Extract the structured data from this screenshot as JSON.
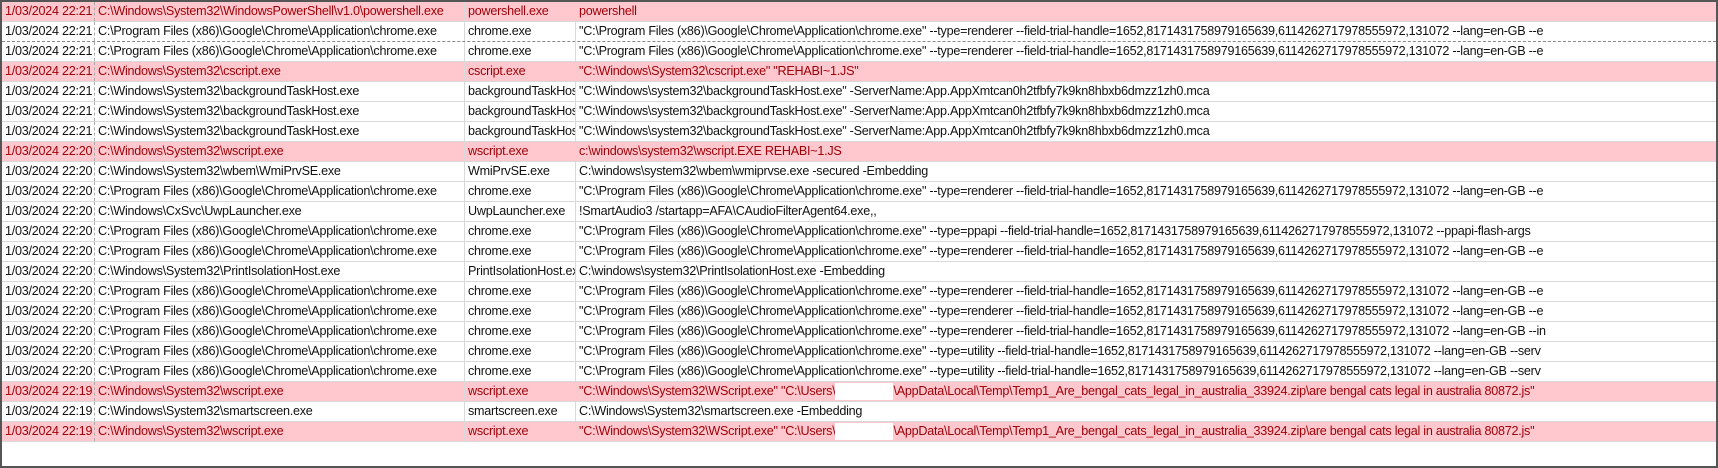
{
  "colors": {
    "highlight_fill": "#FFC7CE",
    "highlight_text": "#9C0006"
  },
  "rows": [
    {
      "hl": true,
      "time": "1/03/2024 22:21",
      "path": "C:\\Windows\\System32\\WindowsPowerShell\\v1.0\\powershell.exe",
      "proc": "powershell.exe",
      "cmd": "powershell"
    },
    {
      "hl": false,
      "time": "1/03/2024 22:21",
      "path": "C:\\Program Files (x86)\\Google\\Chrome\\Application\\chrome.exe",
      "proc": "chrome.exe",
      "cmd": "\"C:\\Program Files (x86)\\Google\\Chrome\\Application\\chrome.exe\" --type=renderer --field-trial-handle=1652,8171431758979165639,6114262717978555972,131072 --lang=en-GB --e"
    },
    {
      "hl": false,
      "time": "1/03/2024 22:21",
      "path": "C:\\Program Files (x86)\\Google\\Chrome\\Application\\chrome.exe",
      "proc": "chrome.exe",
      "cmd": "\"C:\\Program Files (x86)\\Google\\Chrome\\Application\\chrome.exe\" --type=renderer --field-trial-handle=1652,8171431758979165639,6114262717978555972,131072 --lang=en-GB --e"
    },
    {
      "hl": true,
      "time": "1/03/2024 22:21",
      "path": "C:\\Windows\\System32\\cscript.exe",
      "proc": "cscript.exe",
      "cmd": "\"C:\\Windows\\System32\\cscript.exe\" \"REHABI~1.JS\""
    },
    {
      "hl": false,
      "time": "1/03/2024 22:21",
      "path": "C:\\Windows\\System32\\backgroundTaskHost.exe",
      "proc": "backgroundTaskHost.exe",
      "cmd": "\"C:\\Windows\\system32\\backgroundTaskHost.exe\" -ServerName:App.AppXmtcan0h2tfbfy7k9kn8hbxb6dmzz1zh0.mca"
    },
    {
      "hl": false,
      "time": "1/03/2024 22:21",
      "path": "C:\\Windows\\System32\\backgroundTaskHost.exe",
      "proc": "backgroundTaskHost.exe",
      "cmd": "\"C:\\Windows\\system32\\backgroundTaskHost.exe\" -ServerName:App.AppXmtcan0h2tfbfy7k9kn8hbxb6dmzz1zh0.mca"
    },
    {
      "hl": false,
      "time": "1/03/2024 22:21",
      "path": "C:\\Windows\\System32\\backgroundTaskHost.exe",
      "proc": "backgroundTaskHost.exe",
      "cmd": "\"C:\\Windows\\system32\\backgroundTaskHost.exe\" -ServerName:App.AppXmtcan0h2tfbfy7k9kn8hbxb6dmzz1zh0.mca"
    },
    {
      "hl": true,
      "time": "1/03/2024 22:20",
      "path": "C:\\Windows\\System32\\wscript.exe",
      "proc": "wscript.exe",
      "cmd": "c:\\windows\\system32\\wscript.EXE REHABI~1.JS"
    },
    {
      "hl": false,
      "time": "1/03/2024 22:20",
      "path": "C:\\Windows\\System32\\wbem\\WmiPrvSE.exe",
      "proc": "WmiPrvSE.exe",
      "cmd": "C:\\windows\\system32\\wbem\\wmiprvse.exe -secured -Embedding"
    },
    {
      "hl": false,
      "time": "1/03/2024 22:20",
      "path": "C:\\Program Files (x86)\\Google\\Chrome\\Application\\chrome.exe",
      "proc": "chrome.exe",
      "cmd": "\"C:\\Program Files (x86)\\Google\\Chrome\\Application\\chrome.exe\" --type=renderer --field-trial-handle=1652,8171431758979165639,6114262717978555972,131072 --lang=en-GB --e"
    },
    {
      "hl": false,
      "time": "1/03/2024 22:20",
      "path": "C:\\Windows\\CxSvc\\UwpLauncher.exe",
      "proc": "UwpLauncher.exe",
      "cmd": " !SmartAudio3 /startapp=AFA\\CAudioFilterAgent64.exe,,"
    },
    {
      "hl": false,
      "time": "1/03/2024 22:20",
      "path": "C:\\Program Files (x86)\\Google\\Chrome\\Application\\chrome.exe",
      "proc": "chrome.exe",
      "cmd": "\"C:\\Program Files (x86)\\Google\\Chrome\\Application\\chrome.exe\" --type=ppapi --field-trial-handle=1652,8171431758979165639,6114262717978555972,131072 --ppapi-flash-args"
    },
    {
      "hl": false,
      "time": "1/03/2024 22:20",
      "path": "C:\\Program Files (x86)\\Google\\Chrome\\Application\\chrome.exe",
      "proc": "chrome.exe",
      "cmd": "\"C:\\Program Files (x86)\\Google\\Chrome\\Application\\chrome.exe\" --type=renderer --field-trial-handle=1652,8171431758979165639,6114262717978555972,131072 --lang=en-GB --e"
    },
    {
      "hl": false,
      "time": "1/03/2024 22:20",
      "path": "C:\\Windows\\System32\\PrintIsolationHost.exe",
      "proc": "PrintIsolationHost.exe",
      "cmd": "C:\\windows\\system32\\PrintIsolationHost.exe -Embedding"
    },
    {
      "hl": false,
      "time": "1/03/2024 22:20",
      "path": "C:\\Program Files (x86)\\Google\\Chrome\\Application\\chrome.exe",
      "proc": "chrome.exe",
      "cmd": "\"C:\\Program Files (x86)\\Google\\Chrome\\Application\\chrome.exe\" --type=renderer --field-trial-handle=1652,8171431758979165639,6114262717978555972,131072 --lang=en-GB --e"
    },
    {
      "hl": false,
      "time": "1/03/2024 22:20",
      "path": "C:\\Program Files (x86)\\Google\\Chrome\\Application\\chrome.exe",
      "proc": "chrome.exe",
      "cmd": "\"C:\\Program Files (x86)\\Google\\Chrome\\Application\\chrome.exe\" --type=renderer --field-trial-handle=1652,8171431758979165639,6114262717978555972,131072 --lang=en-GB --e"
    },
    {
      "hl": false,
      "time": "1/03/2024 22:20",
      "path": "C:\\Program Files (x86)\\Google\\Chrome\\Application\\chrome.exe",
      "proc": "chrome.exe",
      "cmd": "\"C:\\Program Files (x86)\\Google\\Chrome\\Application\\chrome.exe\" --type=renderer --field-trial-handle=1652,8171431758979165639,6114262717978555972,131072 --lang=en-GB --in"
    },
    {
      "hl": false,
      "time": "1/03/2024 22:20",
      "path": "C:\\Program Files (x86)\\Google\\Chrome\\Application\\chrome.exe",
      "proc": "chrome.exe",
      "cmd": "\"C:\\Program Files (x86)\\Google\\Chrome\\Application\\chrome.exe\" --type=utility --field-trial-handle=1652,8171431758979165639,6114262717978555972,131072 --lang=en-GB --serv"
    },
    {
      "hl": false,
      "time": "1/03/2024 22:20",
      "path": "C:\\Program Files (x86)\\Google\\Chrome\\Application\\chrome.exe",
      "proc": "chrome.exe",
      "cmd": "\"C:\\Program Files (x86)\\Google\\Chrome\\Application\\chrome.exe\" --type=utility --field-trial-handle=1652,8171431758979165639,6114262717978555972,131072 --lang=en-GB --serv"
    },
    {
      "hl": true,
      "time": "1/03/2024 22:19",
      "path": "C:\\Windows\\System32\\wscript.exe",
      "proc": "wscript.exe",
      "cmd": "\"C:\\Windows\\System32\\WScript.exe\" \"C:\\Users\\",
      "cmd_after": "\\AppData\\Local\\Temp\\Temp1_Are_bengal_cats_legal_in_australia_33924.zip\\are bengal cats legal in australia 80872.js\""
    },
    {
      "hl": false,
      "time": "1/03/2024 22:19",
      "path": "C:\\Windows\\System32\\smartscreen.exe",
      "proc": "smartscreen.exe",
      "cmd": "C:\\Windows\\System32\\smartscreen.exe -Embedding"
    },
    {
      "hl": true,
      "time": "1/03/2024 22:19",
      "path": "C:\\Windows\\System32\\wscript.exe",
      "proc": "wscript.exe",
      "cmd": "\"C:\\Windows\\System32\\WScript.exe\" \"C:\\Users\\",
      "cmd_after": "\\AppData\\Local\\Temp\\Temp1_Are_bengal_cats_legal_in_australia_33924.zip\\are bengal cats legal in australia 80872.js\""
    }
  ]
}
